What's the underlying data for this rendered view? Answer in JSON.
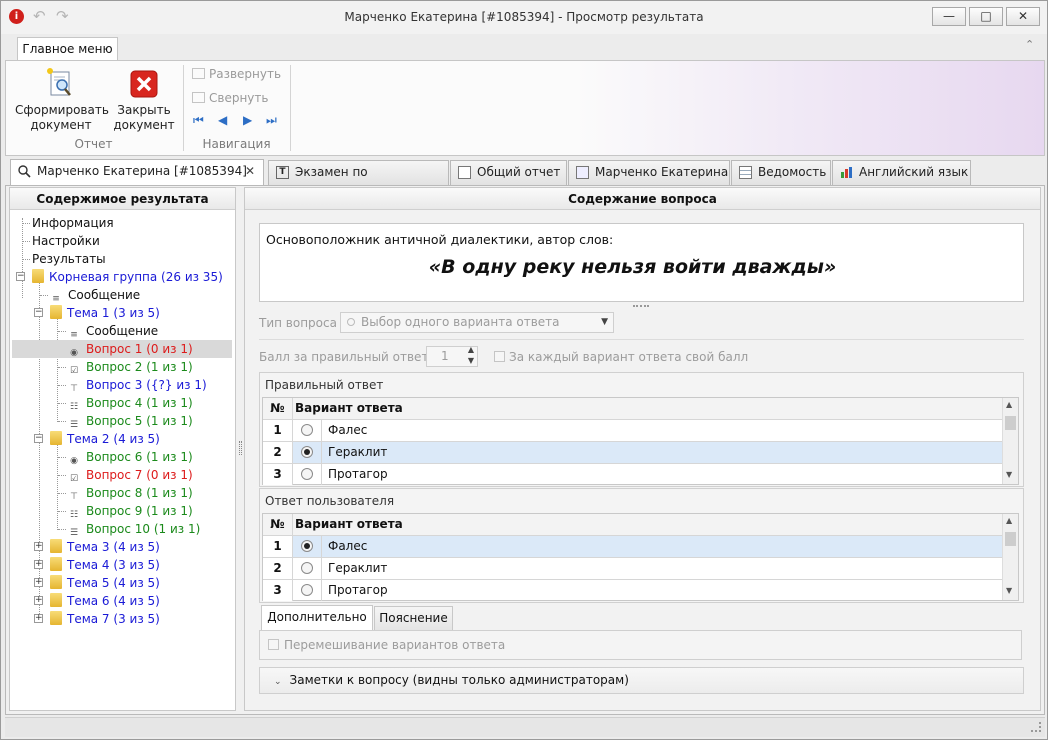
{
  "window": {
    "title": "Марченко Екатерина [#1085394] - Просмотр результата",
    "app_icon": "i",
    "controls": {
      "minimize": "—",
      "maximize": "□",
      "close": "✕"
    },
    "qa_undo": "↶",
    "qa_redo": "↷",
    "ribbon_collapse": "⌃"
  },
  "ribbon": {
    "tab": "Главное меню",
    "report_group": {
      "label": "Отчет",
      "form_line1": "Сформировать",
      "form_line2": "документ",
      "close_line1": "Закрыть",
      "close_line2": "документ"
    },
    "nav_group": {
      "label": "Навигация",
      "expand": "Развернуть",
      "collapse": "Свернуть",
      "first": "⏮",
      "prev": "◀",
      "next": "▶",
      "last": "⏭"
    }
  },
  "doc_tabs": [
    {
      "label": "Марченко Екатерина [#1085394]",
      "icon": "search-icon"
    },
    {
      "label": "Экзамен по английскому",
      "icon": "text-icon"
    },
    {
      "label": "Общий отчет",
      "icon": "document-icon"
    },
    {
      "label": "Марченко Екатерина",
      "icon": "person-icon"
    },
    {
      "label": "Ведомость",
      "icon": "table-icon"
    },
    {
      "label": "Английский язык",
      "icon": "chart-icon"
    }
  ],
  "doc_tab_close": "✕",
  "left_panel": {
    "title": "Содержимое результата",
    "tree": [
      {
        "label": "Информация",
        "color": "black"
      },
      {
        "label": "Настройки",
        "color": "black"
      },
      {
        "label": "Результаты",
        "color": "black"
      },
      {
        "label": "Корневая группа (26 из 35)",
        "color": "blue",
        "toggle": "−"
      },
      {
        "label": "Сообщение",
        "color": "black",
        "icon": "≡"
      },
      {
        "label": "Тема 1 (3 из 5)",
        "color": "blue",
        "toggle": "−"
      },
      {
        "label": "Сообщение",
        "color": "black",
        "icon": "≡"
      },
      {
        "label": "Вопрос 1 (0 из 1)",
        "color": "red",
        "icon": "◉",
        "selected": true
      },
      {
        "label": "Вопрос 2 (1 из 1)",
        "color": "green",
        "icon": "☑"
      },
      {
        "label": "Вопрос 3 ({?} из 1)",
        "color": "blue",
        "icon": "⊤"
      },
      {
        "label": "Вопрос 4 (1 из 1)",
        "color": "green",
        "icon": "☷"
      },
      {
        "label": "Вопрос 5 (1 из 1)",
        "color": "green",
        "icon": "☰"
      },
      {
        "label": "Тема 2 (4 из 5)",
        "color": "blue",
        "toggle": "−"
      },
      {
        "label": "Вопрос 6 (1 из 1)",
        "color": "green",
        "icon": "◉"
      },
      {
        "label": "Вопрос 7 (0 из 1)",
        "color": "red",
        "icon": "☑"
      },
      {
        "label": "Вопрос 8 (1 из 1)",
        "color": "green",
        "icon": "⊤"
      },
      {
        "label": "Вопрос 9 (1 из 1)",
        "color": "green",
        "icon": "☷"
      },
      {
        "label": "Вопрос 10 (1 из 1)",
        "color": "green",
        "icon": "☰"
      },
      {
        "label": "Тема 3 (4 из 5)",
        "color": "blue",
        "toggle": "+"
      },
      {
        "label": "Тема 4 (3 из 5)",
        "color": "blue",
        "toggle": "+"
      },
      {
        "label": "Тема 5 (4 из 5)",
        "color": "blue",
        "toggle": "+"
      },
      {
        "label": "Тема 6 (4 из 5)",
        "color": "blue",
        "toggle": "+"
      },
      {
        "label": "Тема 7 (3 из 5)",
        "color": "blue",
        "toggle": "+"
      }
    ]
  },
  "right_panel": {
    "title": "Содержание вопроса",
    "question_intro": "Основоположник античной диалектики, автор слов:",
    "question_quote": "«В одну реку нельзя войти дважды»",
    "question_type_label": "Тип вопроса",
    "question_type_value": "Выбор одного варианта ответа",
    "score_label": "Балл за правильный ответ",
    "score_value": "1",
    "per_option_score_label": "За каждый вариант ответа свой балл",
    "correct_answer_label": "Правильный ответ",
    "user_answer_label": "Ответ пользователя",
    "col_num": "№",
    "col_option": "Вариант ответа",
    "correct_answers": [
      {
        "num": "1",
        "text": "Фалес",
        "checked": false
      },
      {
        "num": "2",
        "text": "Гераклит",
        "checked": true
      },
      {
        "num": "3",
        "text": "Протагор",
        "checked": false
      }
    ],
    "user_answers": [
      {
        "num": "1",
        "text": "Фалес",
        "checked": true
      },
      {
        "num": "2",
        "text": "Гераклит",
        "checked": false
      },
      {
        "num": "3",
        "text": "Протагор",
        "checked": false
      }
    ],
    "bottom_tabs": [
      "Дополнительно",
      "Пояснение"
    ],
    "shuffle_label": "Перемешивание вариантов ответа",
    "notes_label": "Заметки к вопросу (видны только администраторам)"
  },
  "colors": {
    "selected_row": "#dbe9f8",
    "tree_selected": "#d9d9d9",
    "blue": "#1a1ad6",
    "green": "#1b8a1b",
    "red": "#dd1b1b"
  }
}
